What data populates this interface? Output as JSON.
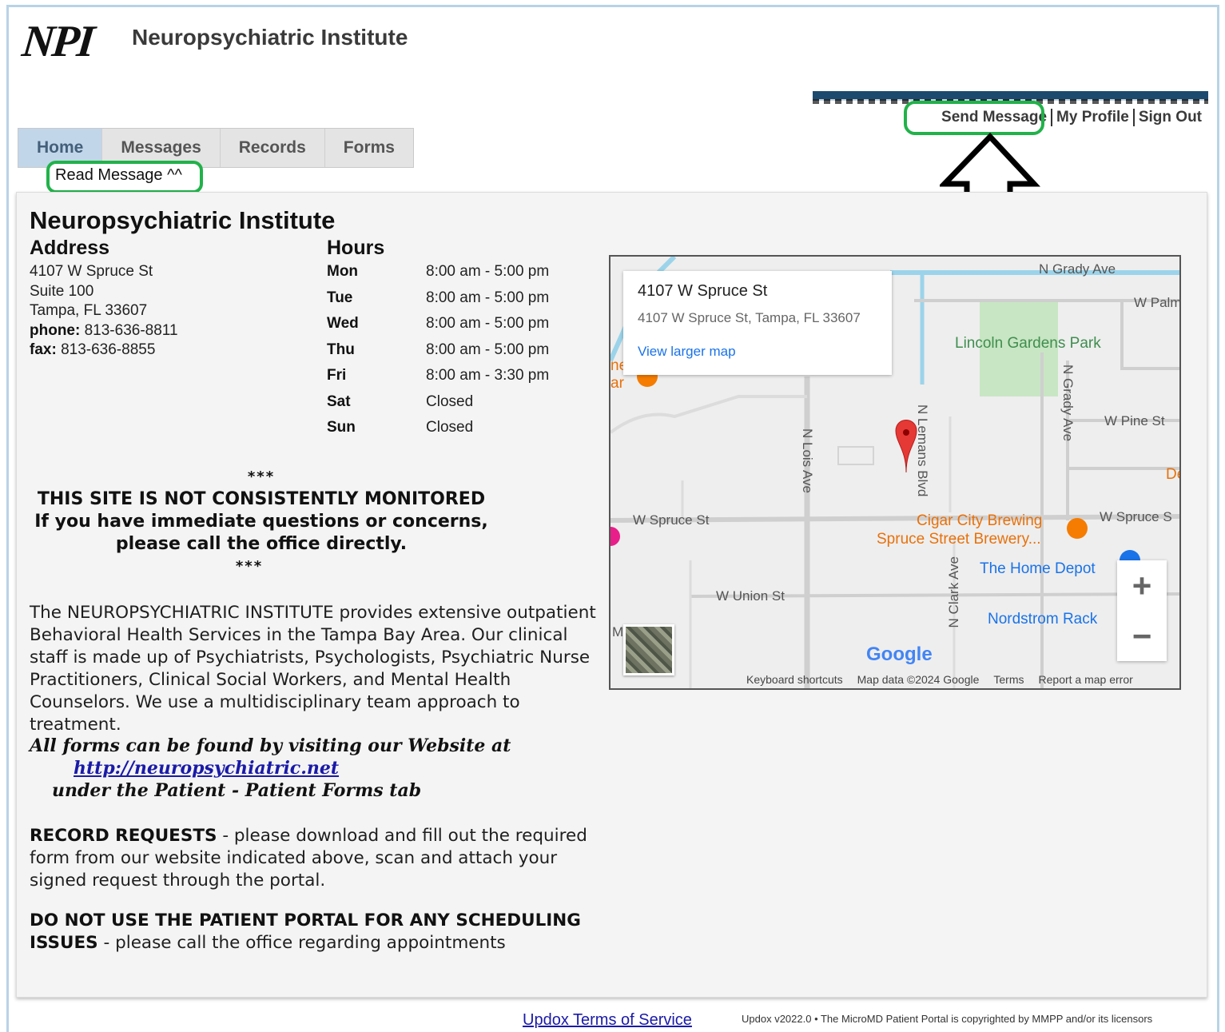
{
  "header": {
    "logo": "NPI",
    "title": "Neuropsychiatric Institute",
    "links": [
      "Send Message",
      "My Profile",
      "Sign Out"
    ]
  },
  "tabs": [
    "Home",
    "Messages",
    "Records",
    "Forms"
  ],
  "annotation": {
    "read_message": "Read Message ^^"
  },
  "practice": {
    "name": "Neuropsychiatric Institute",
    "address_heading": "Address",
    "address_lines": [
      "4107 W Spruce St",
      "Suite 100",
      "Tampa, FL 33607"
    ],
    "phone_label": "phone:",
    "phone": "813-636-8811",
    "fax_label": "fax:",
    "fax": "813-636-8855",
    "hours_heading": "Hours",
    "hours": [
      {
        "day": "Mon",
        "time": "8:00 am - 5:00 pm"
      },
      {
        "day": "Tue",
        "time": "8:00 am - 5:00 pm"
      },
      {
        "day": "Wed",
        "time": "8:00 am - 5:00 pm"
      },
      {
        "day": "Thu",
        "time": "8:00 am - 5:00 pm"
      },
      {
        "day": "Fri",
        "time": "8:00 am - 3:30 pm"
      },
      {
        "day": "Sat",
        "time": "Closed"
      },
      {
        "day": "Sun",
        "time": "Closed"
      }
    ]
  },
  "notice": {
    "stars": "***",
    "line1": "THIS SITE IS NOT CONSISTENTLY MONITORED",
    "line2": "If you have immediate questions or concerns,",
    "line3": "please call the office directly."
  },
  "about": "The NEUROPSYCHIATRIC INSTITUTE provides extensive outpatient Behavioral Health Services in the Tampa Bay Area. Our clinical staff is made up of Psychiatrists, Psychologists, Psychiatric Nurse Practitioners, Clinical Social Workers, and Mental Health Counselors. We use a multidisciplinary team approach to treatment.",
  "forms_note": {
    "line1": "All forms can be found by visiting our Website at",
    "url": "http://neuropsychiatric.net",
    "line3": "under the Patient - Patient Forms tab"
  },
  "record_requests": {
    "label": "RECORD REQUESTS",
    "text": " - please download and fill out the required form from our website indicated above, scan and attach your signed request through the portal."
  },
  "scheduling": {
    "label": "DO NOT USE THE PATIENT PORTAL FOR ANY SCHEDULING ISSUES",
    "text": " - please call the office regarding appointments"
  },
  "map": {
    "card_title": "4107 W Spruce St",
    "card_address": "4107 W Spruce St, Tampa, FL 33607",
    "card_link": "View larger map",
    "streets": {
      "grady_top": "N Grady Ave",
      "palm": "W Palm",
      "pine": "W Pine St",
      "spruce_left": "W Spruce St",
      "spruce_right": "W Spruce S",
      "union": "W Union St",
      "lois": "N Lois Ave",
      "lemans": "N Lemans Blvd",
      "grady_v": "N Grady Ave",
      "clark": "N Clark Ave",
      "de": "De",
      "m": "M",
      "ne": "ne",
      "ar": "ar"
    },
    "park": "Lincoln Gardens Park",
    "pois": {
      "brewing1": "Cigar City Brewing",
      "brewing2": "Spruce Street Brewery...",
      "home_depot": "The Home Depot",
      "nordstrom": "Nordstrom Rack"
    },
    "zoom_in": "+",
    "zoom_out": "−",
    "brand": "Google",
    "footer": [
      "Keyboard shortcuts",
      "Map data ©2024 Google",
      "Terms",
      "Report a map error"
    ]
  },
  "footer": {
    "link": "Updox Terms of Service",
    "copyright": "Updox v2022.0 • The MicroMD Patient Portal is copyrighted by MMPP and/or its licensors"
  },
  "colors": {
    "highlight_green": "#21b24a",
    "active_tab": "#c2d6ea",
    "link_blue": "#1a1aa8"
  }
}
